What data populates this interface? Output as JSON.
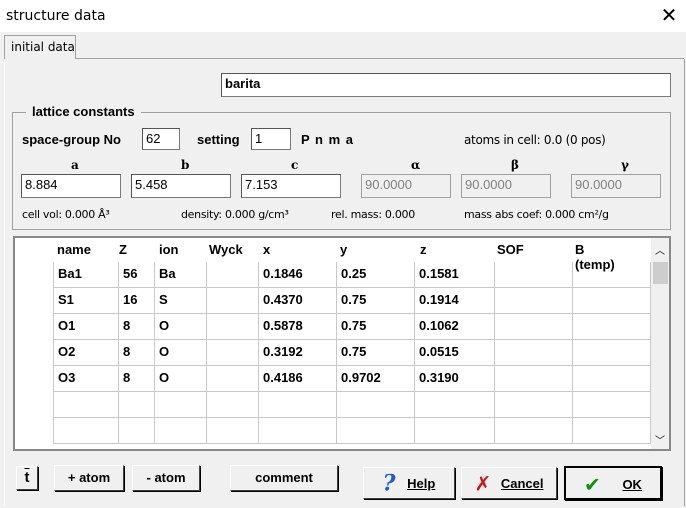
{
  "window": {
    "title": "structure data",
    "close": "✕"
  },
  "tabs": [
    "initial data"
  ],
  "name_field": "barita",
  "lattice": {
    "group_label": "lattice constants",
    "space_group_label": "space-group No",
    "space_group_value": "62",
    "setting_label": "setting",
    "setting_value": "1",
    "symbol": "P n m a",
    "atoms_in_cell": "atoms in cell: 0.0   (0 pos)",
    "params": [
      {
        "label": "a",
        "value": "8.884",
        "disabled": false
      },
      {
        "label": "b",
        "value": "5.458",
        "disabled": false
      },
      {
        "label": "c",
        "value": "7.153",
        "disabled": false
      },
      {
        "label": "α",
        "value": "90.0000",
        "disabled": true
      },
      {
        "label": "β",
        "value": "90.0000",
        "disabled": true
      },
      {
        "label": "γ",
        "value": "90.0000",
        "disabled": true
      }
    ],
    "cell_vol": "cell vol: 0.000 Å³",
    "density": "density: 0.000 g/cm³",
    "rel_mass": "rel. mass: 0.000",
    "mass_abs": "mass abs coef: 0.000 cm²/g"
  },
  "table": {
    "headers": [
      "name",
      "Z",
      "ion",
      "Wyck",
      "x",
      "y",
      "z",
      "SOF",
      "B (temp)"
    ],
    "rows": [
      [
        "Ba1",
        "56",
        "Ba",
        "",
        "0.1846",
        "0.25",
        "0.1581",
        "",
        ""
      ],
      [
        "S1",
        "16",
        "S",
        "",
        "0.4370",
        "0.75",
        "0.1914",
        "",
        ""
      ],
      [
        "O1",
        "8",
        "O",
        "",
        "0.5878",
        "0.75",
        "0.1062",
        "",
        ""
      ],
      [
        "O2",
        "8",
        "O",
        "",
        "0.3192",
        "0.75",
        "0.0515",
        "",
        ""
      ],
      [
        "O3",
        "8",
        "O",
        "",
        "0.4186",
        "0.9702",
        "0.3190",
        "",
        ""
      ],
      [
        "",
        "",
        "",
        "",
        "",
        "",
        "",
        "",
        ""
      ],
      [
        "",
        "",
        "",
        "",
        "",
        "",
        "",
        "",
        ""
      ]
    ]
  },
  "buttons": {
    "t_icon": "t",
    "add_atom": "+ atom",
    "remove_atom": "- atom",
    "comment": "comment",
    "help": "Help",
    "cancel": "Cancel",
    "ok": "OK"
  }
}
